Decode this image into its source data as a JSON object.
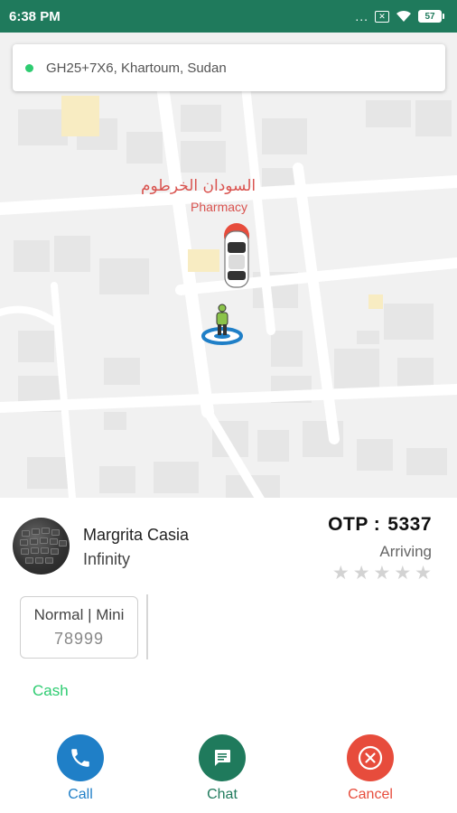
{
  "status_bar": {
    "time": "6:38 PM",
    "more_indicator": "...",
    "sim_icon": "no-sim-icon",
    "wifi_icon": "wifi-icon",
    "battery_level": "57"
  },
  "map": {
    "address": "GH25+7X6, Khartoum, Sudan",
    "label_arabic": "السودان الخرطوم",
    "label_english": "Pharmacy",
    "car_icon": "car-marker-icon",
    "person_icon": "person-pin-icon"
  },
  "driver": {
    "name": "Margrita Casia",
    "car_model": "Infinity"
  },
  "otp": {
    "label": "OTP :",
    "value": "5337"
  },
  "trip_status": "Arriving",
  "rating": {
    "max_stars": 5,
    "filled": 0
  },
  "vehicle": {
    "type": "Normal | Mini",
    "number": "78999"
  },
  "payment_method": "Cash",
  "actions": {
    "call": "Call",
    "chat": "Chat",
    "cancel": "Cancel"
  },
  "colors": {
    "status_bar": "#1f7a5c",
    "call": "#1f7fc7",
    "chat": "#1f7a5c",
    "cancel": "#e74c3c",
    "cash": "#2ecc71",
    "map_label": "#d9534f"
  }
}
